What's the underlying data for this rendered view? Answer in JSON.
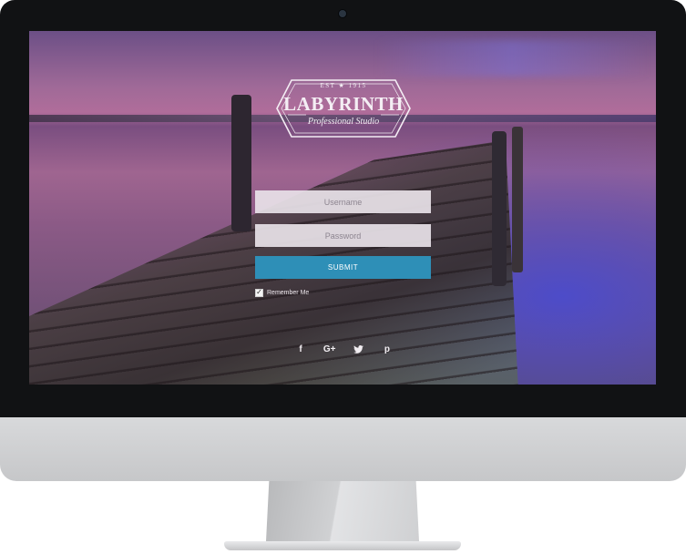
{
  "logo": {
    "est": "EST ★ 1915",
    "name": "LABYRINTH",
    "tagline": "Professional Studio"
  },
  "login": {
    "username_placeholder": "Username",
    "password_placeholder": "Password",
    "submit_label": "SUBMIT",
    "remember_label": "Remember Me",
    "remember_checked": true
  },
  "social": [
    {
      "icon": "facebook-icon",
      "glyph": "f"
    },
    {
      "icon": "google-plus-icon",
      "glyph": "G+"
    },
    {
      "icon": "twitter-icon",
      "glyph": "t"
    },
    {
      "icon": "pinterest-icon",
      "glyph": "p"
    }
  ],
  "colors": {
    "submit": "#2e8fb7",
    "bezel": "#111214",
    "chin": "#d3d4d6"
  }
}
